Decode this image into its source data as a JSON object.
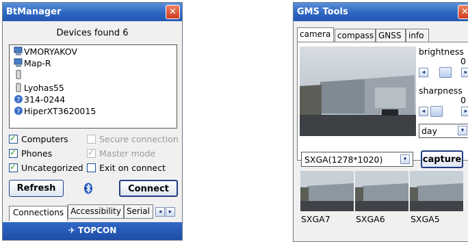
{
  "bt": {
    "title": "BtManager",
    "devices_found": "Devices found 6",
    "devices": [
      {
        "name": "VMORYAKOV",
        "icon": "computer-icon"
      },
      {
        "name": "Map-R",
        "icon": "computer-icon"
      },
      {
        "name": "",
        "icon": "phone-icon"
      },
      {
        "name": "Lyohas55",
        "icon": "phone-icon"
      },
      {
        "name": "314-0244",
        "icon": "unknown-device-icon"
      },
      {
        "name": "HiperXT3620015",
        "icon": "unknown-device-icon"
      }
    ],
    "checks": {
      "computers": "Computers",
      "phones": "Phones",
      "uncategorized": "Uncategorized",
      "secure": "Secure connection",
      "master": "Master mode",
      "exit": "Exit on connect"
    },
    "refresh": "Refresh",
    "connect": "Connect",
    "tabs": [
      "Connections",
      "Accessibility",
      "Serial P"
    ],
    "brand": "TOPCON"
  },
  "gms": {
    "title": "GMS Tools",
    "tabs": [
      "camera",
      "compass",
      "GNSS",
      "info"
    ],
    "brightness_label": "brightness",
    "brightness_value": "0",
    "sharpness_label": "sharpness",
    "sharpness_value": "0",
    "mode": "day",
    "resolution": "SXGA(1278*1020)",
    "capture": "capture",
    "thumbnails": [
      "SXGA7",
      "SXGA6",
      "SXGA5"
    ]
  }
}
